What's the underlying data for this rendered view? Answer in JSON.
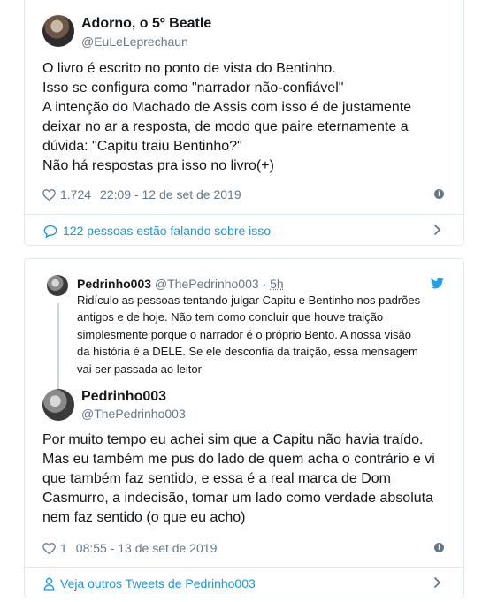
{
  "tweet1": {
    "author_name": "Adorno, o 5º Beatle",
    "author_handle": "@EuLeLeprechaun",
    "lines": [
      "O livro é escrito no ponto de vista do Bentinho.",
      "Isso se configura como \"narrador não-confiável\"",
      "A intenção do Machado de Assis com isso é de justamente",
      "deixar no ar a resposta, de modo que paire eternamente a",
      "dúvida: \"Capitu traiu Bentinho?\"",
      "Não há respostas pra isso no livro(+)"
    ],
    "likes": "1.724",
    "timestamp": "22:09 - 12 de set de 2019",
    "conversation_link": "122 pessoas estão falando sobre isso"
  },
  "quoted": {
    "author_name": "Pedrinho003",
    "author_handle": "@ThePedrinho003",
    "dot": "·",
    "age": "5h",
    "lines": [
      "Ridículo as pessoas tentando julgar Capitu e Bentinho nos padrões",
      "antigos e de hoje. Não tem como concluir que houve traição",
      "simplesmente porque o narrador é o próprio Bento. A nossa visão",
      "da história é a DELE. Se ele desconfia da traição, essa mensagem",
      "vai ser passada ao leitor"
    ]
  },
  "tweet2": {
    "author_name": "Pedrinho003",
    "author_handle": "@ThePedrinho003",
    "lines": [
      "Por muito tempo eu achei sim que a Capitu não havia traído.",
      "Mas eu também me pus do lado de quem acha o contrário e vi",
      "que também faz sentido, e essa é a real marca de Dom",
      "Casmurro, a indecisão, tomar um lado como verdade absoluta",
      "nem faz sentido (o que eu acho)"
    ],
    "likes": "1",
    "timestamp": "08:55 - 13 de set de 2019",
    "more_link": "Veja outros Tweets de Pedrinho003"
  },
  "icons": {
    "like": "heart-icon",
    "info": "info-icon",
    "conversation": "speech-bubble-icon",
    "profile": "person-icon",
    "chevron": "chevron-right-icon",
    "brand": "twitter-bird-icon"
  },
  "colors": {
    "link": "#1b95e0",
    "secondary_text": "#657786",
    "border": "#e1e8ed",
    "brand": "#1da1f2"
  }
}
